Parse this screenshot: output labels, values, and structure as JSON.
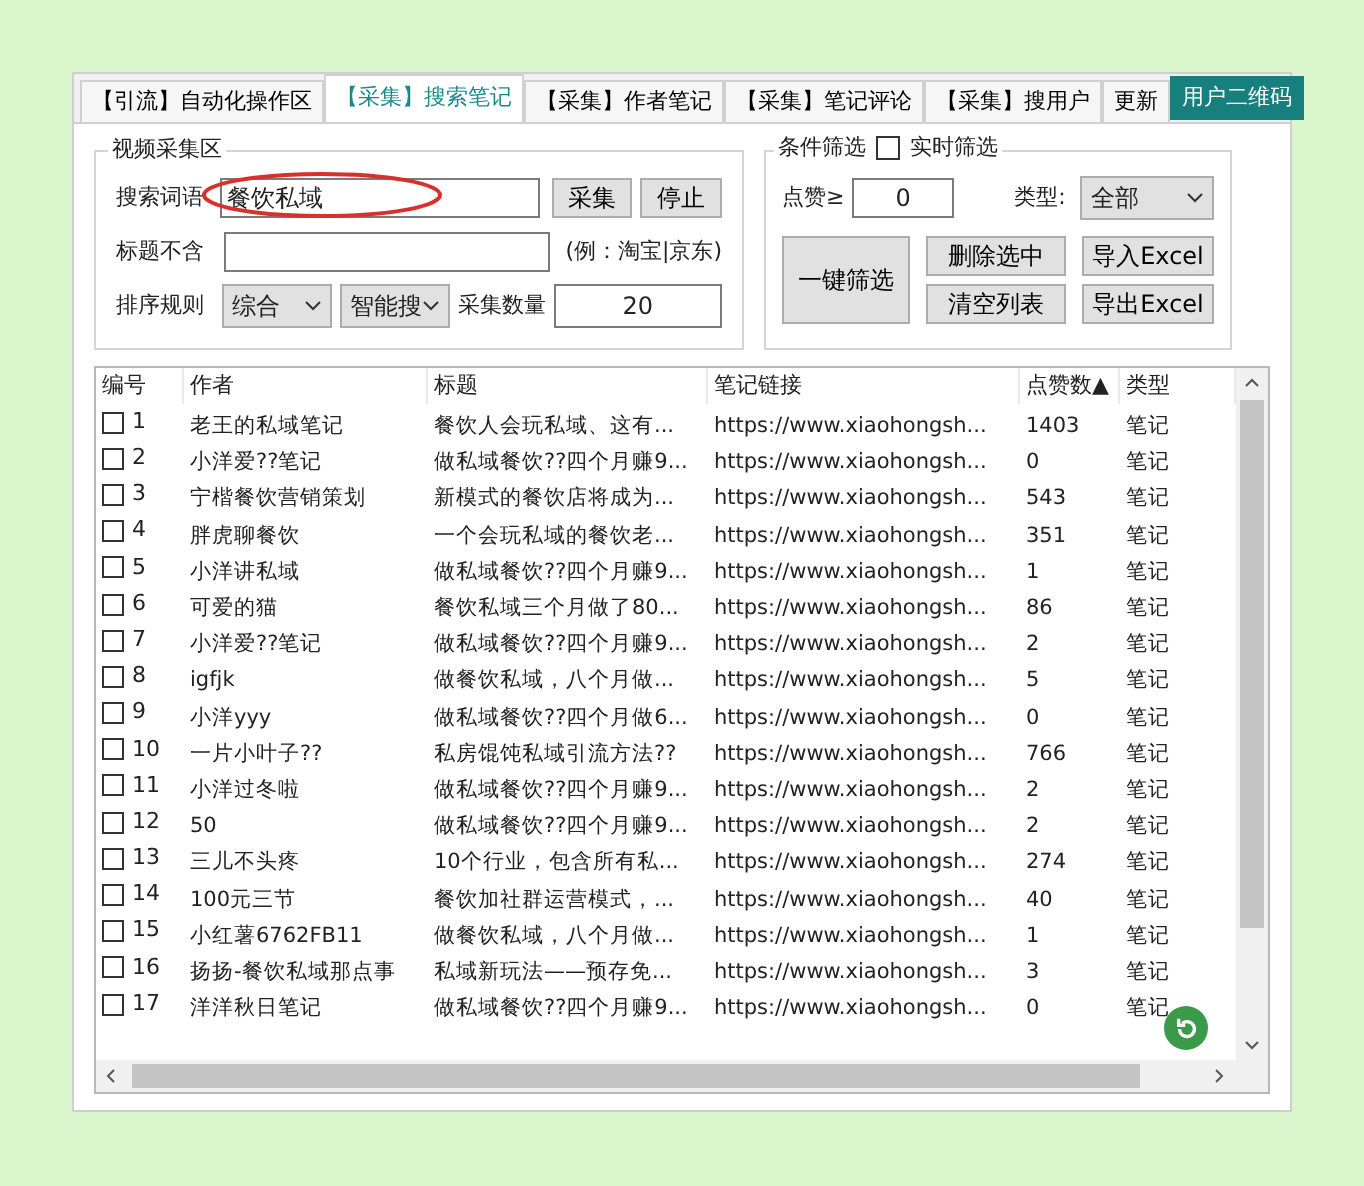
{
  "tabs": [
    {
      "label": "【引流】自动化操作区",
      "selected": false
    },
    {
      "label": "【采集】搜索笔记",
      "selected": true
    },
    {
      "label": "【采集】作者笔记",
      "selected": false
    },
    {
      "label": "【采集】笔记评论",
      "selected": false
    },
    {
      "label": "【采集】搜用户",
      "selected": false
    },
    {
      "label": "更新",
      "selected": false
    }
  ],
  "qr_button": "用户二维码",
  "collect_group": {
    "title": "视频采集区",
    "search_label": "搜索词语",
    "search_value": "餐饮私域",
    "collect_button": "采集",
    "stop_button": "停止",
    "exclude_label": "标题不含",
    "exclude_hint": "(例：淘宝|京东)",
    "sort_label": "排序规则",
    "sort_value": "综合",
    "mode_value": "智能搜",
    "count_label": "采集数量",
    "count_value": "20"
  },
  "filter_group": {
    "title": "条件筛选",
    "realtime_label": "实时筛选",
    "realtime_checked": false,
    "likes_label": "点赞≥",
    "likes_value": "0",
    "type_label": "类型:",
    "type_value": "全部",
    "filter_button": "一键筛选",
    "delete_button": "删除选中",
    "import_button": "导入Excel",
    "clear_button": "清空列表",
    "export_button": "导出Excel"
  },
  "table": {
    "columns": [
      "编号",
      "作者",
      "标题",
      "笔记链接",
      "点赞数▲",
      "类型"
    ],
    "rows": [
      {
        "checked": false,
        "cells": [
          "1",
          "老王的私域笔记",
          "餐饮人会玩私域、这有...",
          "https://www.xiaohongsh...",
          "1403",
          "笔记"
        ]
      },
      {
        "checked": false,
        "cells": [
          "2",
          "小洋爱??笔记",
          "做私域餐饮??四个月赚9...",
          "https://www.xiaohongsh...",
          "0",
          "笔记"
        ]
      },
      {
        "checked": false,
        "cells": [
          "3",
          "宁楷餐饮营销策划",
          "新模式的餐饮店将成为...",
          "https://www.xiaohongsh...",
          "543",
          "笔记"
        ]
      },
      {
        "checked": false,
        "cells": [
          "4",
          "胖虎聊餐饮",
          "一个会玩私域的餐饮老...",
          "https://www.xiaohongsh...",
          "351",
          "笔记"
        ]
      },
      {
        "checked": false,
        "cells": [
          "5",
          "小洋讲私域",
          "做私域餐饮??四个月赚9...",
          "https://www.xiaohongsh...",
          "1",
          "笔记"
        ]
      },
      {
        "checked": false,
        "cells": [
          "6",
          "可爱的猫",
          "餐饮私域三个月做了80...",
          "https://www.xiaohongsh...",
          "86",
          "笔记"
        ]
      },
      {
        "checked": false,
        "cells": [
          "7",
          "小洋爱??笔记",
          "做私域餐饮??四个月赚9...",
          "https://www.xiaohongsh...",
          "2",
          "笔记"
        ]
      },
      {
        "checked": false,
        "cells": [
          "8",
          "igfjk",
          "做餐饮私域，八个月做...",
          "https://www.xiaohongsh...",
          "5",
          "笔记"
        ]
      },
      {
        "checked": false,
        "cells": [
          "9",
          "小洋yyy",
          "做私域餐饮??四个月做6...",
          "https://www.xiaohongsh...",
          "0",
          "笔记"
        ]
      },
      {
        "checked": false,
        "cells": [
          "10",
          "一片小叶子??",
          "私房馄饨私域引流方法??",
          "https://www.xiaohongsh...",
          "766",
          "笔记"
        ]
      },
      {
        "checked": false,
        "cells": [
          "11",
          "小洋过冬啦",
          "做私域餐饮??四个月赚9...",
          "https://www.xiaohongsh...",
          "2",
          "笔记"
        ]
      },
      {
        "checked": false,
        "cells": [
          "12",
          "50",
          "做私域餐饮??四个月赚9...",
          "https://www.xiaohongsh...",
          "2",
          "笔记"
        ]
      },
      {
        "checked": false,
        "cells": [
          "13",
          "三儿不头疼",
          "10个行业，包含所有私...",
          "https://www.xiaohongsh...",
          "274",
          "笔记"
        ]
      },
      {
        "checked": false,
        "cells": [
          "14",
          "100元三节",
          "餐饮加社群运营模式，...",
          "https://www.xiaohongsh...",
          "40",
          "笔记"
        ]
      },
      {
        "checked": false,
        "cells": [
          "15",
          "小红薯6762FB11",
          "做餐饮私域，八个月做...",
          "https://www.xiaohongsh...",
          "1",
          "笔记"
        ]
      },
      {
        "checked": false,
        "cells": [
          "16",
          "扬扬-餐饮私域那点事",
          "私域新玩法——预存免...",
          "https://www.xiaohongsh...",
          "3",
          "笔记"
        ]
      },
      {
        "checked": false,
        "cells": [
          "17",
          "洋洋秋日笔记",
          "做私域餐饮??四个月赚9...",
          "https://www.xiaohongsh...",
          "0",
          "笔记"
        ]
      }
    ]
  }
}
